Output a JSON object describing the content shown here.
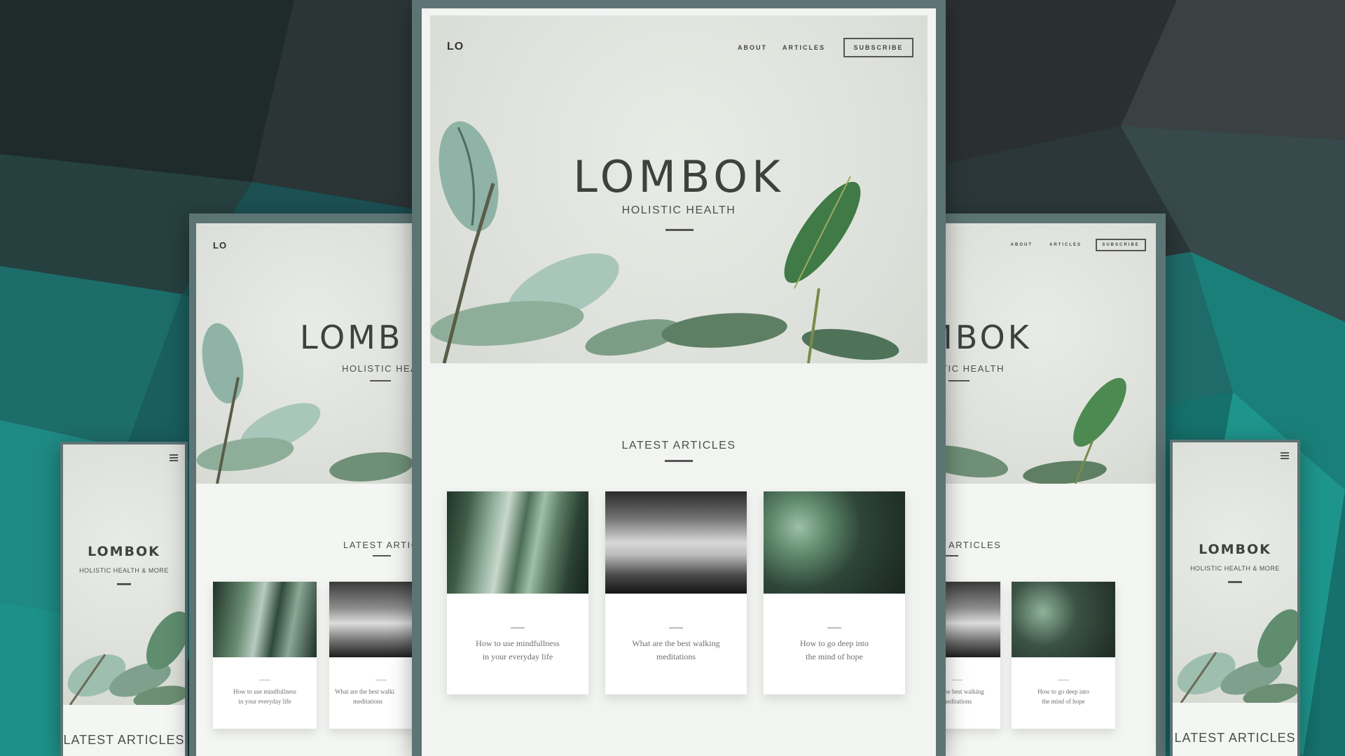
{
  "site": {
    "logo": "LO",
    "title": "LOMBOK",
    "subtitle": "HOLISTIC HEALTH",
    "mobile_subtitle": "HOLISTIC HEALTH & MORE",
    "nav": {
      "about": "ABOUT",
      "articles": "ARTICLES",
      "subscribe": "SUBSCRIBE"
    },
    "section_title": "LATEST ARTICLES",
    "articles": [
      {
        "title_line1": "How to use mindfullness",
        "title_line2": "in your everyday life"
      },
      {
        "title_line1": "What are the best walking",
        "title_line2": "meditations"
      },
      {
        "title_line1": "How to go deep into",
        "title_line2": "the mind of hope"
      }
    ]
  },
  "partial_text": {
    "left_title": "LOMB",
    "left_subtitle": "HOLISTIC HEALT",
    "left_section": "LATEST ARTICL",
    "left_card2_line1": "What are the best walki",
    "right_title": "MBOK",
    "right_subtitle": "LISTIC HEALTH",
    "right_section": "EST ARTICLES",
    "right_card1_line1": "r are the best walking"
  },
  "colors": {
    "background": "#0f3a3b",
    "frame": "#5d7475",
    "accent_leaf": "#6f9a83",
    "text_dark": "#3d4240"
  },
  "icons": [
    "menu-icon",
    "leaf-illustration"
  ]
}
